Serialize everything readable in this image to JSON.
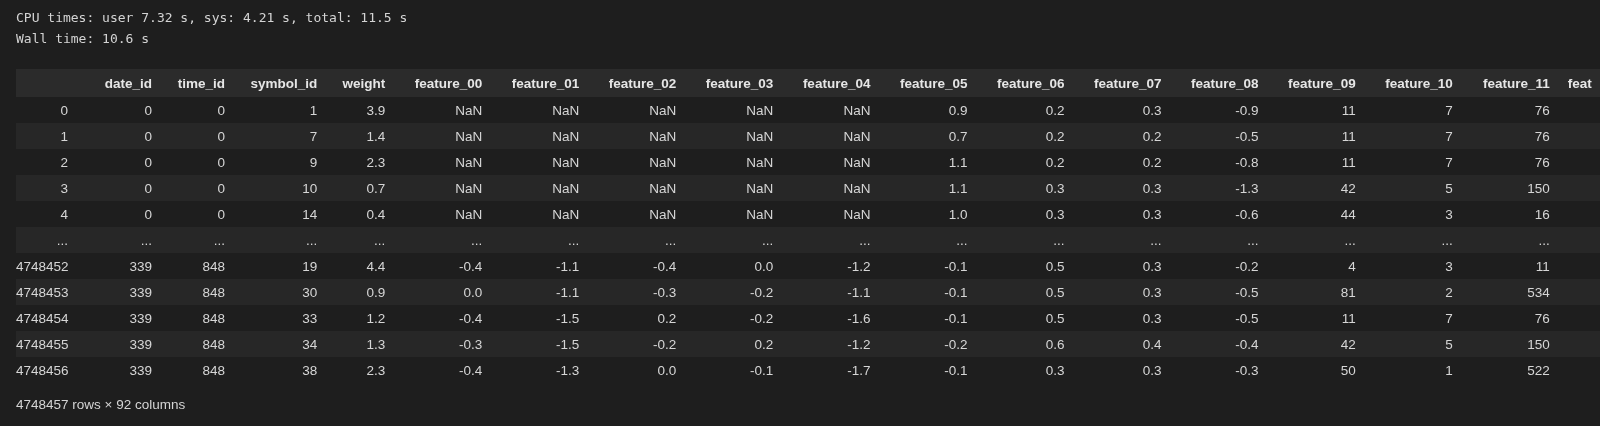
{
  "output_lines": [
    "CPU times: user 7.32 s, sys: 4.21 s, total: 11.5 s",
    "Wall time: 10.6 s"
  ],
  "table": {
    "columns": [
      "date_id",
      "time_id",
      "symbol_id",
      "weight",
      "feature_00",
      "feature_01",
      "feature_02",
      "feature_03",
      "feature_04",
      "feature_05",
      "feature_06",
      "feature_07",
      "feature_08",
      "feature_09",
      "feature_10",
      "feature_11",
      "feat"
    ],
    "rows": [
      {
        "index": "0",
        "cells": [
          "0",
          "0",
          "1",
          "3.9",
          "NaN",
          "NaN",
          "NaN",
          "NaN",
          "NaN",
          "0.9",
          "0.2",
          "0.3",
          "-0.9",
          "11",
          "7",
          "76"
        ]
      },
      {
        "index": "1",
        "cells": [
          "0",
          "0",
          "7",
          "1.4",
          "NaN",
          "NaN",
          "NaN",
          "NaN",
          "NaN",
          "0.7",
          "0.2",
          "0.2",
          "-0.5",
          "11",
          "7",
          "76"
        ]
      },
      {
        "index": "2",
        "cells": [
          "0",
          "0",
          "9",
          "2.3",
          "NaN",
          "NaN",
          "NaN",
          "NaN",
          "NaN",
          "1.1",
          "0.2",
          "0.2",
          "-0.8",
          "11",
          "7",
          "76"
        ]
      },
      {
        "index": "3",
        "cells": [
          "0",
          "0",
          "10",
          "0.7",
          "NaN",
          "NaN",
          "NaN",
          "NaN",
          "NaN",
          "1.1",
          "0.3",
          "0.3",
          "-1.3",
          "42",
          "5",
          "150"
        ]
      },
      {
        "index": "4",
        "cells": [
          "0",
          "0",
          "14",
          "0.4",
          "NaN",
          "NaN",
          "NaN",
          "NaN",
          "NaN",
          "1.0",
          "0.3",
          "0.3",
          "-0.6",
          "44",
          "3",
          "16"
        ]
      },
      {
        "index": "...",
        "cells": [
          "...",
          "...",
          "...",
          "...",
          "...",
          "...",
          "...",
          "...",
          "...",
          "...",
          "...",
          "...",
          "...",
          "...",
          "...",
          "..."
        ]
      },
      {
        "index": "4748452",
        "cells": [
          "339",
          "848",
          "19",
          "4.4",
          "-0.4",
          "-1.1",
          "-0.4",
          "0.0",
          "-1.2",
          "-0.1",
          "0.5",
          "0.3",
          "-0.2",
          "4",
          "3",
          "11"
        ]
      },
      {
        "index": "4748453",
        "cells": [
          "339",
          "848",
          "30",
          "0.9",
          "0.0",
          "-1.1",
          "-0.3",
          "-0.2",
          "-1.1",
          "-0.1",
          "0.5",
          "0.3",
          "-0.5",
          "81",
          "2",
          "534"
        ]
      },
      {
        "index": "4748454",
        "cells": [
          "339",
          "848",
          "33",
          "1.2",
          "-0.4",
          "-1.5",
          "0.2",
          "-0.2",
          "-1.6",
          "-0.1",
          "0.5",
          "0.3",
          "-0.5",
          "11",
          "7",
          "76"
        ]
      },
      {
        "index": "4748455",
        "cells": [
          "339",
          "848",
          "34",
          "1.3",
          "-0.3",
          "-1.5",
          "-0.2",
          "0.2",
          "-1.2",
          "-0.2",
          "0.6",
          "0.4",
          "-0.4",
          "42",
          "5",
          "150"
        ]
      },
      {
        "index": "4748456",
        "cells": [
          "339",
          "848",
          "38",
          "2.3",
          "-0.4",
          "-1.3",
          "0.0",
          "-0.1",
          "-1.7",
          "-0.1",
          "0.3",
          "0.3",
          "-0.3",
          "50",
          "1",
          "522"
        ]
      }
    ]
  },
  "footer": "4748457 rows × 92 columns"
}
